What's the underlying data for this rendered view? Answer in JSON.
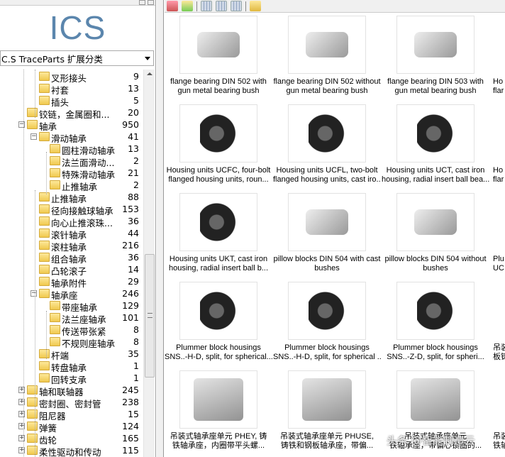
{
  "logo": "ICS",
  "category_select": {
    "value": "C.S TraceParts 扩展分类"
  },
  "tree": [
    {
      "label": "叉形接头",
      "count": "9",
      "level": 2
    },
    {
      "label": "衬套",
      "count": "13",
      "level": 2
    },
    {
      "label": "插头",
      "count": "5",
      "level": 2
    },
    {
      "label": "铰链，金属圈和...",
      "count": "20",
      "level": 1
    },
    {
      "label": "轴承",
      "count": "950",
      "level": 1,
      "expander": "−"
    },
    {
      "label": "滑动轴承",
      "count": "41",
      "level": 2,
      "expander": "−"
    },
    {
      "label": "圆柱滑动轴承",
      "count": "13",
      "level": 3
    },
    {
      "label": "法兰面滑动...",
      "count": "2",
      "level": 3
    },
    {
      "label": "特殊滑动轴承",
      "count": "21",
      "level": 3
    },
    {
      "label": "止推轴承",
      "count": "2",
      "level": 3
    },
    {
      "label": "止推轴承",
      "count": "88",
      "level": 2
    },
    {
      "label": "径向接触球轴承",
      "count": "153",
      "level": 2
    },
    {
      "label": "向心止推滚珠...",
      "count": "36",
      "level": 2
    },
    {
      "label": "滚针轴承",
      "count": "44",
      "level": 2
    },
    {
      "label": "滚柱轴承",
      "count": "216",
      "level": 2
    },
    {
      "label": "组合轴承",
      "count": "36",
      "level": 2
    },
    {
      "label": "凸轮滚子",
      "count": "14",
      "level": 2
    },
    {
      "label": "轴承附件",
      "count": "29",
      "level": 2
    },
    {
      "label": "轴承座",
      "count": "246",
      "level": 2,
      "expander": "−"
    },
    {
      "label": "带座轴承",
      "count": "129",
      "level": 3
    },
    {
      "label": "法兰座轴承",
      "count": "101",
      "level": 3
    },
    {
      "label": "传送带张紧",
      "count": "8",
      "level": 3
    },
    {
      "label": "不规则座轴承",
      "count": "8",
      "level": 3
    },
    {
      "label": "杆端",
      "count": "35",
      "level": 2
    },
    {
      "label": "转盘轴承",
      "count": "1",
      "level": 2
    },
    {
      "label": "回转支承",
      "count": "1",
      "level": 2
    },
    {
      "label": "轴和联轴器",
      "count": "245",
      "level": 1,
      "expander": "+"
    },
    {
      "label": "密封圈、密封管",
      "count": "238",
      "level": 1,
      "expander": "+"
    },
    {
      "label": "阻尼器",
      "count": "15",
      "level": 1,
      "expander": "+"
    },
    {
      "label": "弹簧",
      "count": "124",
      "level": 1,
      "expander": "+"
    },
    {
      "label": "齿轮",
      "count": "165",
      "level": 1,
      "expander": "+"
    },
    {
      "label": "柔性驱动和传动",
      "count": "115",
      "level": 1,
      "expander": "+"
    }
  ],
  "toolbar": [
    "home-icon",
    "up-folder-icon",
    "large-icons-view-icon",
    "list-view-icon",
    "details-view-icon",
    "folders-icon"
  ],
  "items": [
    {
      "line1": "flange bearing DIN 502 with",
      "line2": "gun metal bearing bush",
      "img": "grey"
    },
    {
      "line1": "flange bearing DIN 502 without",
      "line2": "gun metal bearing bush",
      "img": "grey"
    },
    {
      "line1": "flange bearing DIN 503 with",
      "line2": "gun metal bearing bush",
      "img": "grey"
    },
    {
      "line1": "Ho",
      "line2": "flar",
      "img": "none"
    },
    {
      "line1": "Housing units UCFC, four-bolt",
      "line2": "flanged housing units, roun...",
      "img": "dark"
    },
    {
      "line1": "Housing units UCFL, two-bolt",
      "line2": "flanged housing units, cast iro...",
      "img": "dark"
    },
    {
      "line1": "Housing units UCT, cast iron",
      "line2": "housing, radial insert ball bea...",
      "img": "dark"
    },
    {
      "line1": "Ho",
      "line2": "flar",
      "img": "none"
    },
    {
      "line1": "Housing units UKT, cast iron",
      "line2": "housing, radial insert ball b...",
      "img": "dark"
    },
    {
      "line1": "pillow blocks DIN 504 with cast",
      "line2": "bushes",
      "img": "grey"
    },
    {
      "line1": "pillow blocks DIN 504 without",
      "line2": "bushes",
      "img": "grey"
    },
    {
      "line1": "Plu",
      "line2": "UC",
      "img": "none"
    },
    {
      "line1": "Plummer block housings",
      "line2": "SNS..-H-D, split, for spherical...",
      "img": "dark"
    },
    {
      "line1": "Plummer block housings",
      "line2": "SNS..-H-D, split, for spherical ...",
      "img": "dark"
    },
    {
      "line1": "Plummer block housings",
      "line2": "SNS..-Z-D, split, for spheri...",
      "img": "dark"
    },
    {
      "line1": "吊装",
      "line2": "板铸",
      "img": "none"
    },
    {
      "line1": "吊装式轴承座单元 PHEY, 铸",
      "line2": "铁轴承座，内圈带平头螺...",
      "img": "draw"
    },
    {
      "line1": "吊装式轴承座单元 PHUSE,",
      "line2": "铸铁和钢板轴承座，带偏...",
      "img": "draw"
    },
    {
      "line1": "吊装式轴承座单元",
      "line2": "铁轴承座，带偏心锁圈的...",
      "img": "draw"
    },
    {
      "line1": "吊装",
      "line2": "铁轴",
      "img": "none"
    }
  ],
  "watermark": "头条 @智能制造云"
}
